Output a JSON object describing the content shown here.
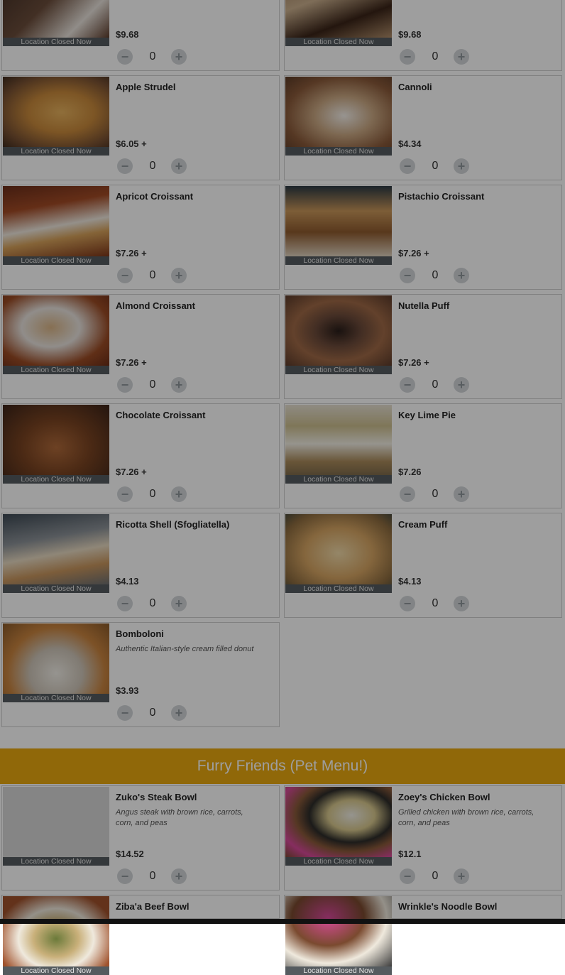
{
  "closed_label": "Location Closed Now",
  "section_banner": "Furry Friends (Pet Menu!)",
  "items_top": [
    {
      "name": "",
      "desc": "",
      "price": "$9.68",
      "qty": "0",
      "image": "chocolate-dessert"
    },
    {
      "name": "",
      "desc": "",
      "price": "$9.68",
      "qty": "0",
      "image": "tiramisu"
    },
    {
      "name": "Apple Strudel",
      "desc": "",
      "price": "$6.05 +",
      "qty": "0",
      "image": "apple-strudel"
    },
    {
      "name": "Cannoli",
      "desc": "",
      "price": "$4.34",
      "qty": "0",
      "image": "cannoli"
    },
    {
      "name": "Apricot Croissant",
      "desc": "",
      "price": "$7.26 +",
      "qty": "0",
      "image": "apricot-croissant"
    },
    {
      "name": "Pistachio Croissant",
      "desc": "",
      "price": "$7.26 +",
      "qty": "0",
      "image": "pistachio-croissant"
    },
    {
      "name": "Almond Croissant",
      "desc": "",
      "price": "$7.26 +",
      "qty": "0",
      "image": "almond-croissant"
    },
    {
      "name": "Nutella Puff",
      "desc": "",
      "price": "$7.26 +",
      "qty": "0",
      "image": "nutella-puff"
    },
    {
      "name": "Chocolate Croissant",
      "desc": "",
      "price": "$7.26 +",
      "qty": "0",
      "image": "chocolate-croissant"
    },
    {
      "name": "Key Lime Pie",
      "desc": "",
      "price": "$7.26",
      "qty": "0",
      "image": "key-lime-pie"
    },
    {
      "name": "Ricotta Shell (Sfogliatella)",
      "desc": "",
      "price": "$4.13",
      "qty": "0",
      "image": "sfogliatella"
    },
    {
      "name": "Cream Puff",
      "desc": "",
      "price": "$4.13",
      "qty": "0",
      "image": "cream-puff"
    },
    {
      "name": "Bomboloni",
      "desc": "Authentic Italian-style cream filled donut",
      "price": "$3.93",
      "qty": "0",
      "image": "bomboloni"
    }
  ],
  "items_pet": [
    {
      "name": "Zuko's Steak Bowl",
      "desc": "Angus steak with brown rice, carrots, corn, and peas",
      "price": "$14.52",
      "qty": "0",
      "image": "blank"
    },
    {
      "name": "Zoey's Chicken Bowl",
      "desc": "Grilled chicken with brown rice, carrots, corn, and peas",
      "price": "$12.1",
      "qty": "0",
      "image": "chicken-bowl"
    },
    {
      "name": "Ziba'a Beef Bowl",
      "desc": "",
      "price": "",
      "qty": "",
      "image": "beef-bowl"
    },
    {
      "name": "Wrinkle's Noodle Bowl",
      "desc": "",
      "price": "",
      "qty": "",
      "image": "noodle-bowl"
    }
  ],
  "icons": {
    "minus": "minus-icon",
    "plus": "plus-icon"
  }
}
